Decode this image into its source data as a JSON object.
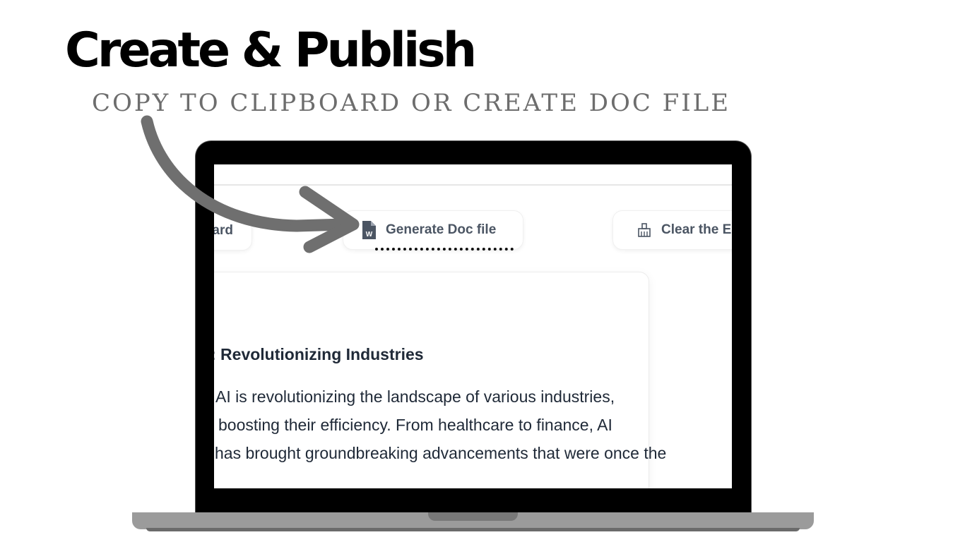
{
  "banner": {
    "title": "Create & Publish",
    "subtitle": "COPY TO CLIPBOARD OR CREATE DOC FILE"
  },
  "toolbar": {
    "copy_label": "Copy to clipboard",
    "doc_label": "Generate Doc file",
    "doc_icon": "word-document-icon",
    "clear_label": "Clear the Editor",
    "clear_icon": "broom-icon"
  },
  "article": {
    "heading": "AI: Revolutionizing Industries",
    "lines": [
      "AI is revolutionizing the landscape of various industries,",
      "boosting their efficiency. From healthcare to finance, AI",
      "has brought groundbreaking advancements that were once the"
    ]
  },
  "colors": {
    "arrow": "#6f6f6f",
    "subtitle": "#6d6d6d",
    "button_text": "#4b5563",
    "laptop_bezel": "#000000",
    "laptop_base": "#9b9b9b"
  }
}
